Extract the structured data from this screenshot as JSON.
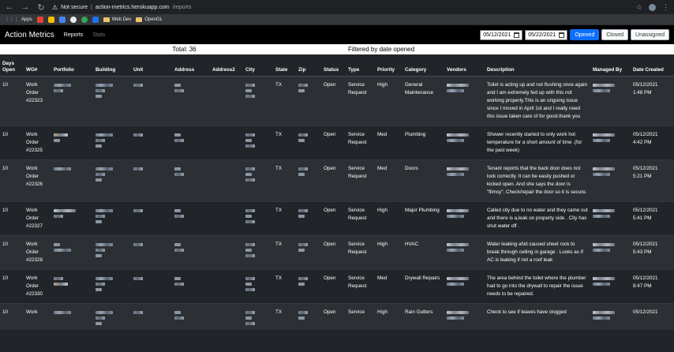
{
  "browser": {
    "not_secure": "Not secure",
    "host": "action-metrics.herokuapp.com",
    "path": "/reports",
    "bookmarks": [
      "Apps",
      "Web Dev",
      "OpenGL"
    ]
  },
  "nav": {
    "brand": "Action Metrics",
    "links": [
      "Reports",
      "Stats"
    ],
    "date_from": "05/12/2021",
    "date_to": "05/22/2021",
    "buttons": [
      "Opened",
      "Closed",
      "Unassigned"
    ]
  },
  "summary": {
    "total": "Total: 36",
    "filter": "Filtered by date opened"
  },
  "table": {
    "headers": [
      "Days Open",
      "WO#",
      "Portfolio",
      "Building",
      "Unit",
      "Address",
      "Address2",
      "City",
      "State",
      "Zip",
      "Status",
      "Type",
      "Priority",
      "Category",
      "Vendors",
      "Description",
      "Managed By",
      "Date Created"
    ],
    "rows": [
      {
        "days": "10",
        "wo": "Work Order #22323",
        "state": "TX",
        "status": "Open",
        "type": "Service Request",
        "priority": "High",
        "category": "General Maintenance",
        "description": "Toilet is acting up and not flushing once again and I am extremely fed up with this not working properly.This is an ongoing issue since I moved in April 1st and I really need this issue taken care of for good.thank you",
        "date": "05/12/2021",
        "time": "1:48 PM"
      },
      {
        "days": "10",
        "wo": "Work Order #22325",
        "state": "TX",
        "status": "Open",
        "type": "Service Request",
        "priority": "Med",
        "category": "Plumbing",
        "description": "Shower recently started to only work hot temperature for a short amount of time .(for the past week)",
        "date": "05/12/2021",
        "time": "4:42 PM"
      },
      {
        "days": "10",
        "wo": "Work Order #22326",
        "state": "TX",
        "status": "Open",
        "type": "Service Request",
        "priority": "Med",
        "category": "Doors",
        "description": "Tenant reports that the back door does not lock correctly. It can be easily pushed or kicked open. And she says the door is \"flimsy\". Check/repair the door so it is secure.",
        "date": "05/12/2021",
        "time": "5:21 PM"
      },
      {
        "days": "10",
        "wo": "Work Order #22327",
        "state": "TX",
        "status": "Open",
        "type": "Service Request",
        "priority": "High",
        "category": "Major Plumbing",
        "description": "Called city due to no water and they came out and there is a,leak on property side . City has shut water off .",
        "date": "05/12/2021",
        "time": "5:41 PM"
      },
      {
        "days": "10",
        "wo": "Work Order #22328",
        "state": "TX",
        "status": "Open",
        "type": "Service Request",
        "priority": "High",
        "category": "HVAC",
        "description": "Water leaking aNd caused sheet rock to break through ceiling in garage . Looks as if AC is leaking if not a roof leak",
        "date": "05/12/2021",
        "time": "5:43 PM"
      },
      {
        "days": "10",
        "wo": "Work Order #22330",
        "state": "TX",
        "status": "Open",
        "type": "Service Request",
        "priority": "Med",
        "category": "Drywall Repairs",
        "description": "The area behind the toilet where the plumber had to go into the drywall to repair the issue needs to be repaired.",
        "date": "05/12/2021",
        "time": "8:47 PM"
      },
      {
        "days": "10",
        "wo": "Work",
        "state": "TX",
        "status": "Open",
        "type": "Service",
        "priority": "High",
        "category": "Rain Gutters",
        "description": "Check to see if leaves have clogged",
        "date": "05/12/2021",
        "time": ""
      }
    ]
  }
}
